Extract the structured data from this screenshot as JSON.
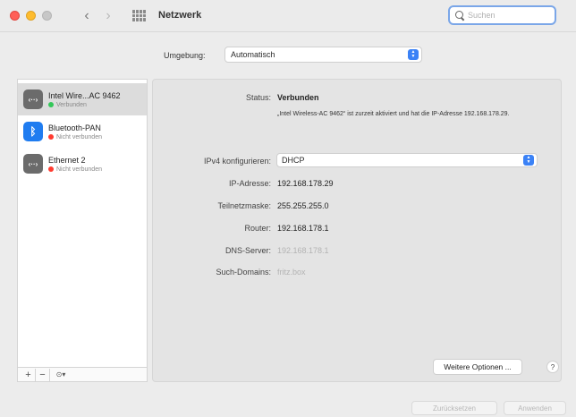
{
  "window": {
    "title": "Netzwerk"
  },
  "search": {
    "placeholder": "Suchen",
    "value": ""
  },
  "environment": {
    "label": "Umgebung:",
    "value": "Automatisch"
  },
  "services": [
    {
      "name": "Intel Wire...AC 9462",
      "status": "Verbunden",
      "status_color": "#34c759",
      "icon": "wifi-ethernet-icon",
      "selected": true
    },
    {
      "name": "Bluetooth-PAN",
      "status": "Nicht verbunden",
      "status_color": "#ff3b30",
      "icon": "bluetooth-icon",
      "selected": false
    },
    {
      "name": "Ethernet 2",
      "status": "Nicht verbunden",
      "status_color": "#ff3b30",
      "icon": "ethernet-icon",
      "selected": false
    }
  ],
  "sidebar_footer": {
    "add": "+",
    "remove": "−",
    "action": "⊙▾"
  },
  "details": {
    "status_label": "Status:",
    "status_value": "Verbunden",
    "status_description": "„Intel Wireless-AC 9462“ ist zurzeit aktiviert und hat die IP-Adresse 192.168.178.29.",
    "ipv4_label": "IPv4 konfigurieren:",
    "ipv4_value": "DHCP",
    "ip_label": "IP-Adresse:",
    "ip_value": "192.168.178.29",
    "subnet_label": "Teilnetzmaske:",
    "subnet_value": "255.255.255.0",
    "router_label": "Router:",
    "router_value": "192.168.178.1",
    "dns_label": "DNS-Server:",
    "dns_value": "192.168.178.1",
    "domains_label": "Such-Domains:",
    "domains_value": "fritz.box"
  },
  "buttons": {
    "more_options": "Weitere Optionen ...",
    "help": "?",
    "revert": "Zurücksetzen",
    "apply": "Anwenden"
  },
  "colors": {
    "accent": "#3b82f6",
    "connected": "#34c759",
    "disconnected": "#ff3b30"
  }
}
